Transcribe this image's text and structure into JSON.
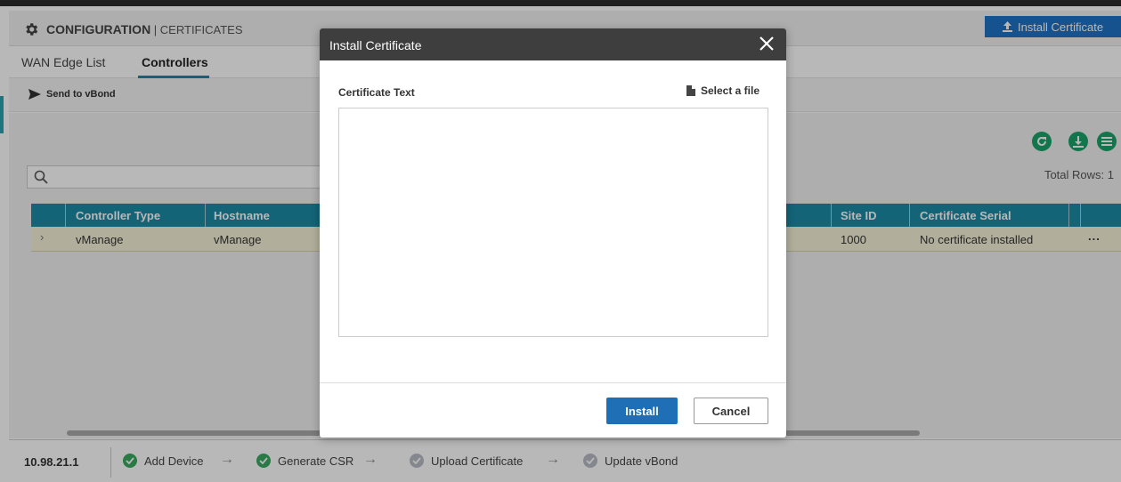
{
  "header": {
    "title": "CONFIGURATION",
    "separator": " | ",
    "subtitle": "CERTIFICATES",
    "install_button": "Install Certificate"
  },
  "tabs": [
    {
      "label": "WAN Edge List",
      "active": false
    },
    {
      "label": "Controllers",
      "active": true
    }
  ],
  "actions": {
    "send_to_vbond": "Send to vBond"
  },
  "toolbar": {
    "total_rows": "Total Rows: 1",
    "search_placeholder": ""
  },
  "table": {
    "columns": [
      "Controller Type",
      "Hostname",
      "Site ID",
      "Certificate Serial"
    ],
    "rows": [
      {
        "controller_type": "vManage",
        "hostname": "vManage",
        "site_id": "1000",
        "certificate_serial": "No certificate installed",
        "menu": "..."
      }
    ]
  },
  "footer": {
    "ip": "10.98.21.1",
    "steps": [
      {
        "label": "Add Device",
        "status": "done"
      },
      {
        "label": "Generate CSR",
        "status": "done"
      },
      {
        "label": "Upload Certificate",
        "status": "pending"
      },
      {
        "label": "Update vBond",
        "status": "pending"
      }
    ]
  },
  "modal": {
    "title": "Install Certificate",
    "certificate_text_label": "Certificate Text",
    "select_file_label": "Select a file",
    "certificate_text_value": "",
    "install_label": "Install",
    "cancel_label": "Cancel"
  },
  "colors": {
    "primary_blue": "#1f72c4",
    "table_header": "#1b8ba6",
    "action_green": "#1ba368",
    "step_done": "#3aaa5f",
    "step_pending": "#b8bcc4",
    "modal_header": "#3e3e3e",
    "selected_row": "#f5f3d7"
  },
  "icons": [
    "gear-icon",
    "upload-icon",
    "send-icon",
    "refresh-icon",
    "download-icon",
    "list-menu-icon",
    "search-icon",
    "close-icon",
    "file-icon",
    "check-icon",
    "arrow-right-icon",
    "expand-chevron-icon"
  ]
}
